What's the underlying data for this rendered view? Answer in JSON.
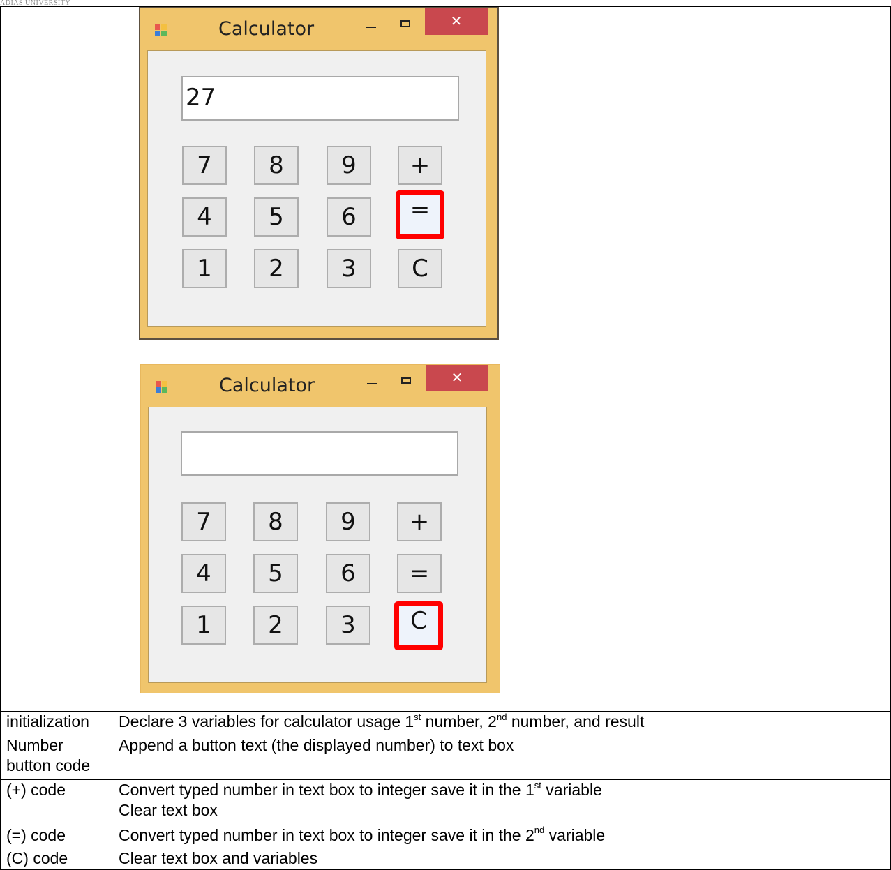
{
  "header_fragment": "ADIAS UNIVERSITY",
  "windows": [
    {
      "title": "Calculator",
      "display_value": "27",
      "keys": [
        "7",
        "8",
        "9",
        "+",
        "4",
        "5",
        "6",
        "=",
        "1",
        "2",
        "3",
        "C"
      ],
      "highlighted_key": "="
    },
    {
      "title": "Calculator",
      "display_value": "",
      "keys": [
        "7",
        "8",
        "9",
        "+",
        "4",
        "5",
        "6",
        "=",
        "1",
        "2",
        "3",
        "C"
      ],
      "highlighted_key": "C"
    }
  ],
  "colors": {
    "window_frame": "#f0c56c",
    "close_button": "#c9484e",
    "highlight": "#ff0000",
    "client_area": "#f0f0f0"
  },
  "rows": [
    {
      "label": "initialization",
      "text_parts": [
        "Declare 3 variables for calculator usage 1",
        "st",
        " number, 2",
        "nd",
        " number, and result"
      ]
    },
    {
      "label": "Number button code",
      "text": "Append a button text (the displayed number) to text box"
    },
    {
      "label": "(+) code",
      "text_parts": [
        "Convert typed number in text box to integer save it in the 1",
        "st",
        "  variable"
      ],
      "line2": "Clear text box"
    },
    {
      "label": "(=) code",
      "text_parts": [
        "Convert typed number in text box to integer save it in the 2",
        "nd",
        " variable"
      ]
    },
    {
      "label": "(C) code",
      "text": "Clear text box and variables"
    }
  ]
}
